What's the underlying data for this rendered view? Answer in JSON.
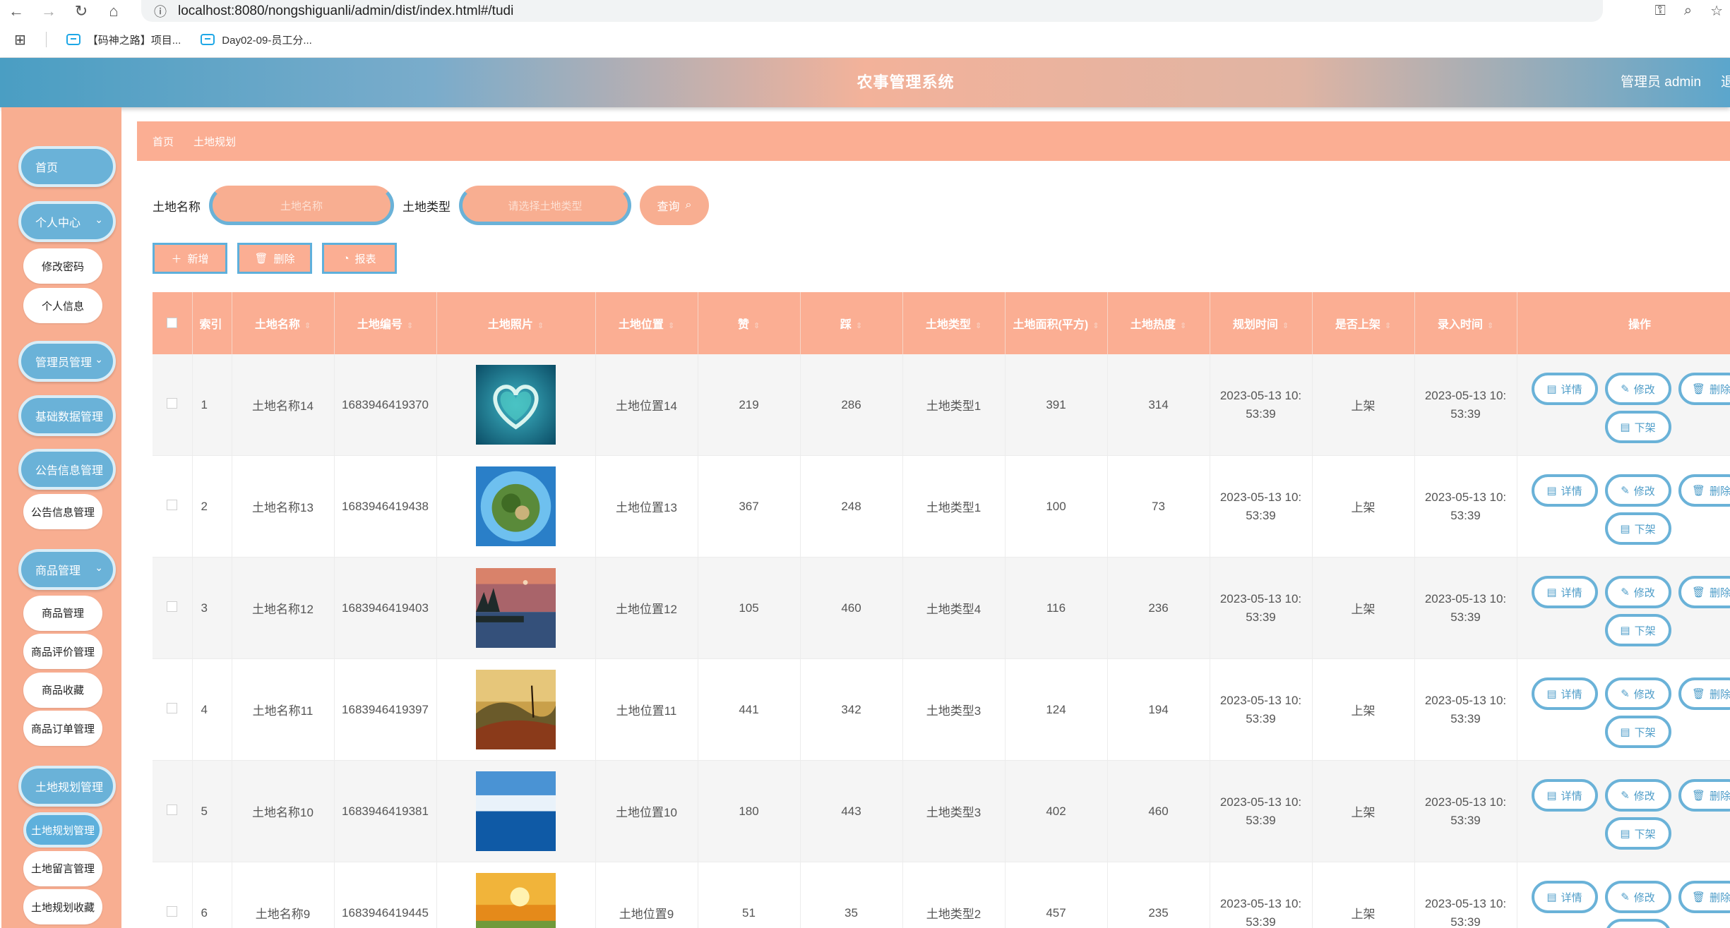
{
  "browser": {
    "url": "localhost:8080/nongshiguanli/admin/dist/index.html#/tudi",
    "bookmarks": [
      "【码神之路】项目...",
      "Day02-09-员工分..."
    ]
  },
  "header": {
    "title": "农事管理系统",
    "user": "管理员 admin",
    "logout": "退"
  },
  "sidebar": {
    "items": [
      {
        "label": "首页",
        "type": "pill"
      },
      {
        "label": "个人中心",
        "type": "pill",
        "chevron": true
      },
      {
        "label": "修改密码",
        "type": "sub"
      },
      {
        "label": "个人信息",
        "type": "sub"
      },
      {
        "label": "管理员管理",
        "type": "pill",
        "chevron": true
      },
      {
        "label": "基础数据管理",
        "type": "pill"
      },
      {
        "label": "公告信息管理",
        "type": "pill"
      },
      {
        "label": "公告信息管理",
        "type": "sub"
      },
      {
        "label": "商品管理",
        "type": "pill",
        "chevron": true
      },
      {
        "label": "商品管理",
        "type": "sub"
      },
      {
        "label": "商品评价管理",
        "type": "sub"
      },
      {
        "label": "商品收藏",
        "type": "sub"
      },
      {
        "label": "商品订单管理",
        "type": "sub"
      },
      {
        "label": "土地规划管理",
        "type": "pill"
      },
      {
        "label": "土地规划管理",
        "type": "sub",
        "active": true
      },
      {
        "label": "土地留言管理",
        "type": "sub"
      },
      {
        "label": "土地规划收藏",
        "type": "sub"
      }
    ]
  },
  "breadcrumb": {
    "home": "首页",
    "current": "土地规划"
  },
  "search": {
    "name_label": "土地名称",
    "name_placeholder": "土地名称",
    "type_label": "土地类型",
    "type_placeholder": "请选择土地类型",
    "button": "查询"
  },
  "actions": {
    "add": "新增",
    "delete": "删除",
    "report": "报表"
  },
  "table": {
    "headers": [
      "索引",
      "土地名称",
      "土地编号",
      "土地照片",
      "土地位置",
      "赞",
      "踩",
      "土地类型",
      "土地面积(平方)",
      "土地热度",
      "规划时间",
      "是否上架",
      "录入时间",
      "操作"
    ],
    "op_labels": {
      "detail": "详情",
      "edit": "修改",
      "delete": "删除",
      "off": "下架"
    },
    "rows": [
      {
        "index": "1",
        "name": "土地名称14",
        "code": "1683946419370",
        "photo": "heart-island",
        "location": "土地位置14",
        "like": "219",
        "dislike": "286",
        "type": "土地类型1",
        "area": "391",
        "heat": "314",
        "plan_time_1": "2023-05-13 10:",
        "plan_time_2": "53:39",
        "status": "上架",
        "entry_time_1": "2023-05-13 10:",
        "entry_time_2": "53:39"
      },
      {
        "index": "2",
        "name": "土地名称13",
        "code": "1683946419438",
        "photo": "tiny-planet",
        "location": "土地位置13",
        "like": "367",
        "dislike": "248",
        "type": "土地类型1",
        "area": "100",
        "heat": "73",
        "plan_time_1": "2023-05-13 10:",
        "plan_time_2": "53:39",
        "status": "上架",
        "entry_time_1": "2023-05-13 10:",
        "entry_time_2": "53:39"
      },
      {
        "index": "3",
        "name": "土地名称12",
        "code": "1683946419403",
        "photo": "lake-dusk",
        "location": "土地位置12",
        "like": "105",
        "dislike": "460",
        "type": "土地类型4",
        "area": "116",
        "heat": "236",
        "plan_time_1": "2023-05-13 10:",
        "plan_time_2": "53:39",
        "status": "上架",
        "entry_time_1": "2023-05-13 10:",
        "entry_time_2": "53:39"
      },
      {
        "index": "4",
        "name": "土地名称11",
        "code": "1683946419397",
        "photo": "mountain-valley",
        "location": "土地位置11",
        "like": "441",
        "dislike": "342",
        "type": "土地类型3",
        "area": "124",
        "heat": "194",
        "plan_time_1": "2023-05-13 10:",
        "plan_time_2": "53:39",
        "status": "上架",
        "entry_time_1": "2023-05-13 10:",
        "entry_time_2": "53:39"
      },
      {
        "index": "5",
        "name": "土地名称10",
        "code": "1683946419381",
        "photo": "blue-sea",
        "location": "土地位置10",
        "like": "180",
        "dislike": "443",
        "type": "土地类型3",
        "area": "402",
        "heat": "460",
        "plan_time_1": "2023-05-13 10:",
        "plan_time_2": "53:39",
        "status": "上架",
        "entry_time_1": "2023-05-13 10:",
        "entry_time_2": "53:39"
      },
      {
        "index": "6",
        "name": "土地名称9",
        "code": "1683946419445",
        "photo": "sunset-field",
        "location": "土地位置9",
        "like": "51",
        "dislike": "35",
        "type": "土地类型2",
        "area": "457",
        "heat": "235",
        "plan_time_1": "2023-05-13 10:",
        "plan_time_2": "53:39",
        "status": "上架",
        "entry_time_1": "2023-05-13 10:",
        "entry_time_2": "53:39"
      }
    ]
  },
  "colors": {
    "accent": "#fbae93",
    "blue": "#6ab2d8"
  }
}
